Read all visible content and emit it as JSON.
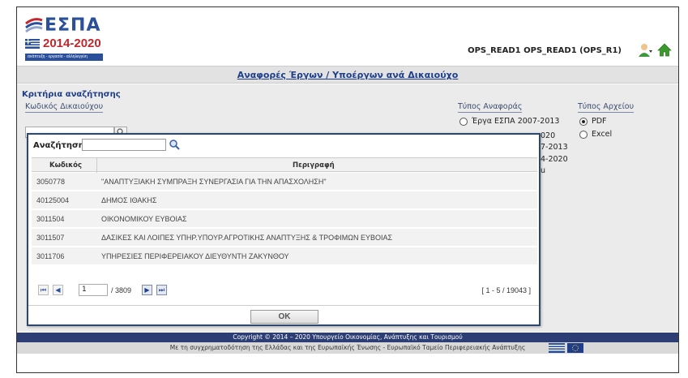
{
  "header": {
    "logo_title": "ΕΣΠΑ",
    "logo_years": "2014-2020",
    "logo_tagline": "ανάπτυξη - εργασία - αλληλεγγύη",
    "user": "OPS_READ1 OPS_READ1 (OPS_R1)"
  },
  "page_title": "Αναφορές Έργων / Υποέργων ανά Δικαιούχο",
  "criteria": {
    "title": "Κριτήρια αναζήτησης",
    "code_label": "Κωδικός Δικαιούχου",
    "code_value": "",
    "report_type_label": "Τύπος Αναφοράς",
    "report_type_options": [
      "Έργα ΕΣΠΑ 2007-2013"
    ],
    "report_type_partial": [
      "020",
      "7-2013",
      "4-2020",
      "u"
    ],
    "file_type_label": "Τύπος Αρχείου",
    "file_type_options": [
      "PDF",
      "Excel"
    ],
    "file_type_selected": "PDF"
  },
  "popup": {
    "search_label": "Αναζήτηση:",
    "search_value": "",
    "col_code": "Κωδικός",
    "col_desc": "Περιγραφή",
    "rows": [
      {
        "code": "3050778",
        "desc": "\"ΑΝΑΠΤΥΞΙΑΚΗ ΣΥΜΠΡΑΞΗ ΣΥΝΕΡΓΑΣΙΑ ΓΙΑ ΤΗΝ ΑΠΑΣΧΟΛΗΣΗ\""
      },
      {
        "code": "40125004",
        "desc": "ΔΗΜΟΣ ΙΘΑΚΗΣ"
      },
      {
        "code": "3011504",
        "desc": "ΟΙΚΟΝΟΜΙΚΟΥ ΕΥΒΟΙΑΣ"
      },
      {
        "code": "3011507",
        "desc": "ΔΑΣΙΚΕΣ ΚΑΙ ΛΟΙΠΕΣ ΥΠΗΡ.ΥΠΟΥΡ.ΑΓΡΟΤΙΚΗΣ ΑΝΑΠΤΥΞΗΣ & ΤΡΟΦΙΜΩΝ ΕΥΒΟΙΑΣ"
      },
      {
        "code": "3011706",
        "desc": "ΥΠΗΡΕΣΙΕΣ ΠΕΡΙΦΕΡΕΙΑΚΟΥ ΔΙΕΥΘΥΝΤΗ ΖΑΚΥΝΘΟΥ"
      }
    ],
    "pager": {
      "first": "⏮",
      "prev": "◀",
      "next": "▶",
      "last": "⏭",
      "page": "1",
      "total_pages": "/ 3809",
      "range": "[ 1 - 5 / 19043 ]"
    },
    "ok_label": "OK"
  },
  "footer": {
    "copyright": "Copyright © 2014 – 2020 Υπουργείο Οικονομίας, Ανάπτυξης και Τουρισμού",
    "cofund": "Με τη συγχρηματοδότηση της Ελλάδας και της Ευρωπαϊκής Ένωσης - Ευρωπαϊκό Ταμείο Περιφερειακής Ανάπτυξης"
  },
  "colors": {
    "brand_blue": "#2a4f9b",
    "brand_red": "#c2272d",
    "footer_navy": "#2c3e73",
    "link_blue": "#1f3e89"
  },
  "icons": [
    "espa-swoosh-icon",
    "greece-flag-icon",
    "user-menu-icon",
    "home-icon",
    "search-icon",
    "eu-flag-icon"
  ]
}
